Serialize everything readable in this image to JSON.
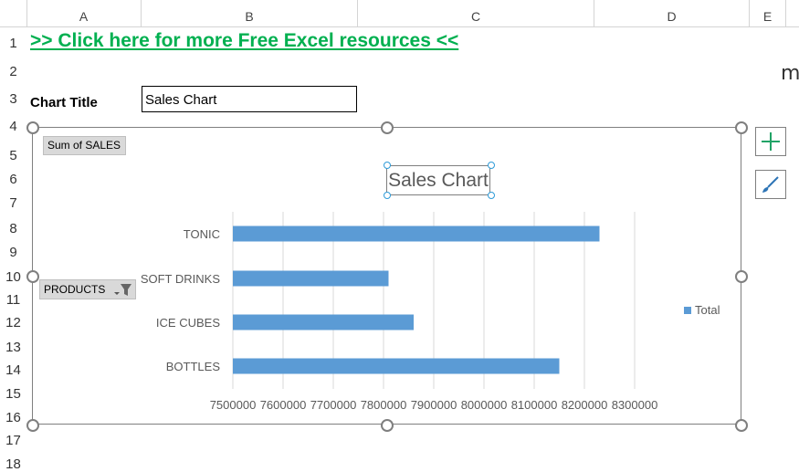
{
  "sheet": {
    "columns": [
      "A",
      "B",
      "C",
      "D",
      "E"
    ],
    "rows": [
      "1",
      "2",
      "3",
      "4",
      "5",
      "6",
      "7",
      "8",
      "9",
      "10",
      "11",
      "12",
      "13",
      "14",
      "15",
      "16",
      "17",
      "18"
    ],
    "link_text": ">> Click here for more Free Excel resources <<",
    "chart_title_label": "Chart Title",
    "chart_title_value": "Sales Chart"
  },
  "chart_ui": {
    "values_field_button": "Sum of SALES",
    "axis_field_button": "PRODUCTS",
    "add_element_icon": "plus-icon",
    "style_icon": "brush-icon"
  },
  "colors": {
    "bar": "#5b9bd5",
    "link": "#00b050",
    "grid": "#d9d9d9"
  },
  "chart_data": {
    "type": "bar",
    "orientation": "horizontal",
    "title": "Sales Chart",
    "categories": [
      "TONIC",
      "SOFT DRINKS",
      "ICE CUBES",
      "BOTTLES"
    ],
    "series": [
      {
        "name": "Total",
        "values": [
          8230000,
          7810000,
          7860000,
          8150000
        ]
      }
    ],
    "xlim": [
      7500000,
      8300000
    ],
    "xticks": [
      "7500000",
      "7600000",
      "7700000",
      "7800000",
      "7900000",
      "8000000",
      "8100000",
      "8200000",
      "8300000"
    ],
    "grid": true,
    "legend": "right"
  }
}
